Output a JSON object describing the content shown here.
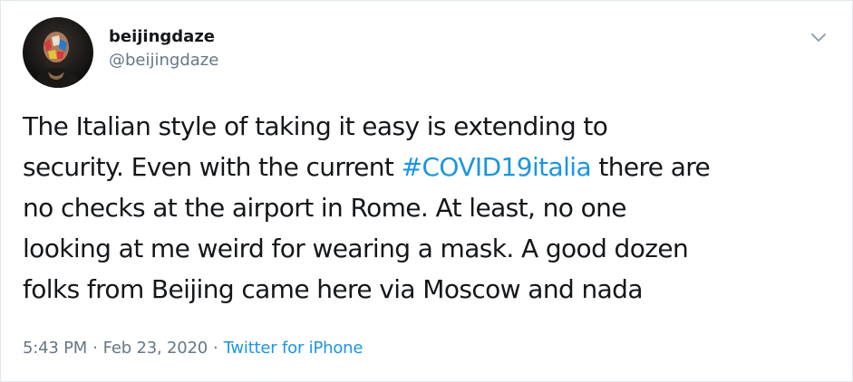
{
  "tweet": {
    "display_name": "beijingdaze",
    "handle": "@beijingdaze",
    "text_lines": [
      {
        "before": "The Italian style of taking it easy is extending to",
        "hashtag": "",
        "after": ""
      },
      {
        "before": "security. Even with the current ",
        "hashtag": "#COVID19italia",
        "after": " there are"
      },
      {
        "before": "no checks at the airport in Rome. At least, no one",
        "hashtag": "",
        "after": ""
      },
      {
        "before": "looking at me weird for wearing a mask. A good dozen",
        "hashtag": "",
        "after": ""
      },
      {
        "before": "folks from Beijing came here via Moscow and nada",
        "hashtag": "",
        "after": ""
      }
    ],
    "time": "5:43 PM",
    "separator": "·",
    "date": "Feb 23, 2020",
    "source": "Twitter for iPhone"
  },
  "icons": {
    "caret": "chevron-down-icon",
    "avatar": "avatar"
  },
  "colors": {
    "link": "#1b95e0",
    "secondary_text": "#657786",
    "primary_text": "#14171a",
    "border": "#e1e8ed"
  }
}
